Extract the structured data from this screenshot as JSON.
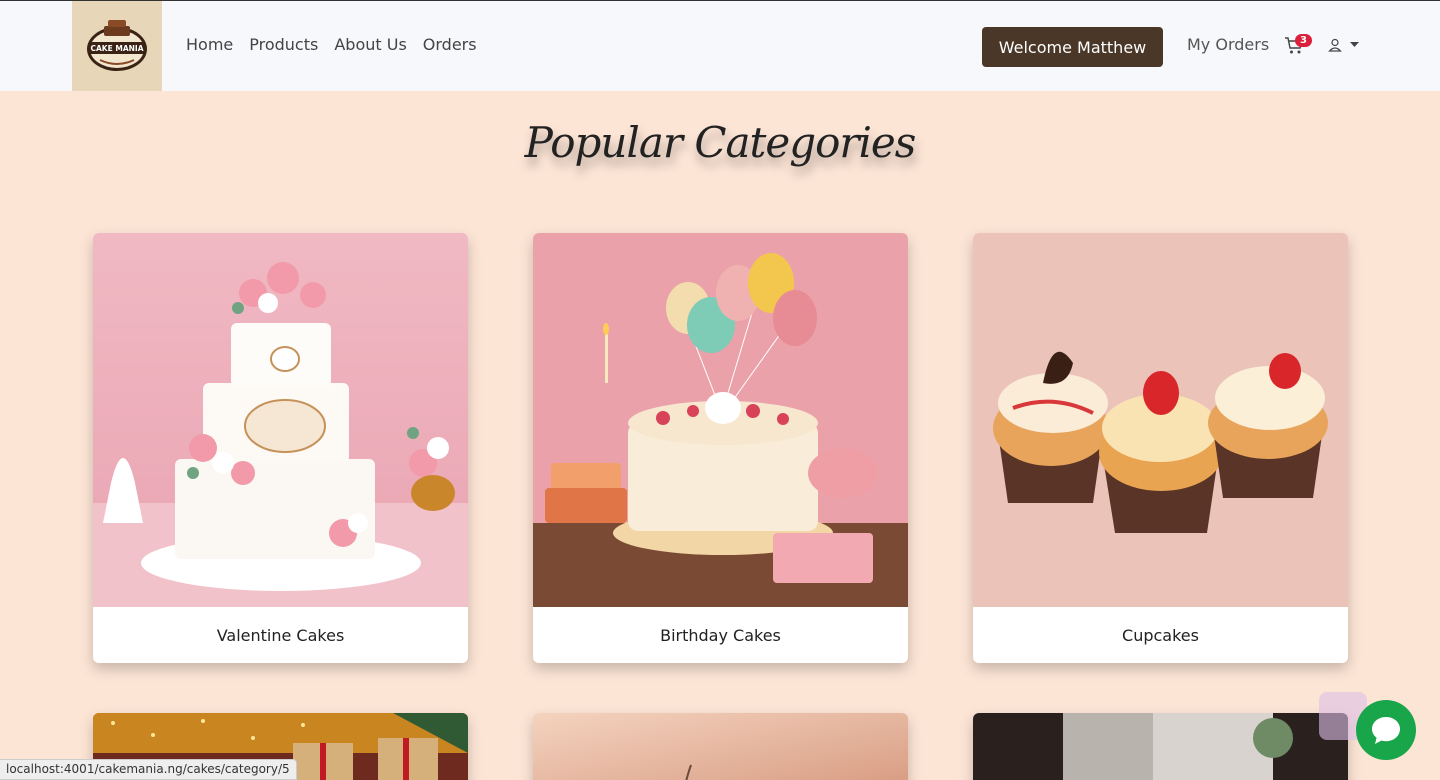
{
  "brand": {
    "logo_text": "CAKE MANIA"
  },
  "nav": {
    "links": [
      "Home",
      "Products",
      "About Us",
      "Orders"
    ],
    "welcome": "Welcome Matthew",
    "my_orders": "My Orders",
    "cart_count": "3"
  },
  "main": {
    "title": "Popular Categories",
    "categories": [
      {
        "label": "Valentine Cakes"
      },
      {
        "label": "Birthday Cakes"
      },
      {
        "label": "Cupcakes"
      }
    ]
  },
  "status_url": "localhost:4001/cakemania.ng/cakes/category/5",
  "colors": {
    "navbar_bg": "#f7f8fb",
    "page_bg": "#fde5d6",
    "welcome_bg": "#4a3728",
    "badge": "#dc1f3a",
    "chat": "#19a64a"
  }
}
